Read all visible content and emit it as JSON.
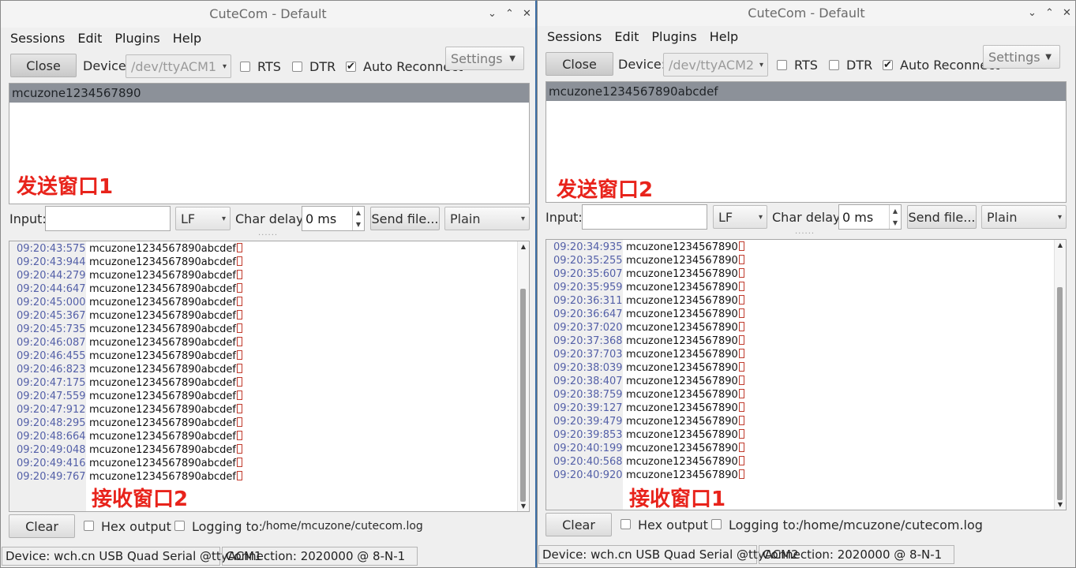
{
  "windows": [
    {
      "title": "CuteCom - Default",
      "menu": [
        "Sessions",
        "Edit",
        "Plugins",
        "Help"
      ],
      "toolbar": {
        "close_label": "Close",
        "device_label": "Device:",
        "device_value": "/dev/ttyACM1",
        "rts_label": "RTS",
        "dtr_label": "DTR",
        "auto_reconnect_label": "Auto Reconnect",
        "settings_label": "Settings"
      },
      "send_history": "mcuzone1234567890",
      "send_annotation": "发送窗口1",
      "input_row": {
        "input_label": "Input:",
        "line_end": "LF",
        "char_delay_label": "Char delay:",
        "char_delay_value": "0 ms",
        "send_file_label": "Send file...",
        "mode": "Plain"
      },
      "output_lines": [
        {
          "ts": "09:20:43:575",
          "text": "mcuzone1234567890abcdef"
        },
        {
          "ts": "09:20:43:944",
          "text": "mcuzone1234567890abcdef"
        },
        {
          "ts": "09:20:44:279",
          "text": "mcuzone1234567890abcdef"
        },
        {
          "ts": "09:20:44:647",
          "text": "mcuzone1234567890abcdef"
        },
        {
          "ts": "09:20:45:000",
          "text": "mcuzone1234567890abcdef"
        },
        {
          "ts": "09:20:45:367",
          "text": "mcuzone1234567890abcdef"
        },
        {
          "ts": "09:20:45:735",
          "text": "mcuzone1234567890abcdef"
        },
        {
          "ts": "09:20:46:087",
          "text": "mcuzone1234567890abcdef"
        },
        {
          "ts": "09:20:46:455",
          "text": "mcuzone1234567890abcdef"
        },
        {
          "ts": "09:20:46:823",
          "text": "mcuzone1234567890abcdef"
        },
        {
          "ts": "09:20:47:175",
          "text": "mcuzone1234567890abcdef"
        },
        {
          "ts": "09:20:47:559",
          "text": "mcuzone1234567890abcdef"
        },
        {
          "ts": "09:20:47:912",
          "text": "mcuzone1234567890abcdef"
        },
        {
          "ts": "09:20:48:295",
          "text": "mcuzone1234567890abcdef"
        },
        {
          "ts": "09:20:48:664",
          "text": "mcuzone1234567890abcdef"
        },
        {
          "ts": "09:20:49:048",
          "text": "mcuzone1234567890abcdef"
        },
        {
          "ts": "09:20:49:416",
          "text": "mcuzone1234567890abcdef"
        },
        {
          "ts": "09:20:49:767",
          "text": "mcuzone1234567890abcdef"
        }
      ],
      "output_annotation": "接收窗口2",
      "bottom": {
        "clear_label": "Clear",
        "hex_output_label": "Hex output",
        "logging_label": "Logging to:",
        "log_path": "/home/mcuzone/cutecom.log"
      },
      "status": {
        "device": "Device:  wch.cn USB Quad Serial @ttyACM1",
        "connection": "Connection:  2020000 @ 8-N-1"
      }
    },
    {
      "title": "CuteCom - Default",
      "menu": [
        "Sessions",
        "Edit",
        "Plugins",
        "Help"
      ],
      "toolbar": {
        "close_label": "Close",
        "device_label": "Device:",
        "device_value": "/dev/ttyACM2",
        "rts_label": "RTS",
        "dtr_label": "DTR",
        "auto_reconnect_label": "Auto Reconnect",
        "settings_label": "Settings"
      },
      "send_history": "mcuzone1234567890abcdef",
      "send_annotation": "发送窗口2",
      "input_row": {
        "input_label": "Input:",
        "line_end": "LF",
        "char_delay_label": "Char delay:",
        "char_delay_value": "0 ms",
        "send_file_label": "Send file...",
        "mode": "Plain"
      },
      "output_lines": [
        {
          "ts": "09:20:34:935",
          "text": "mcuzone1234567890"
        },
        {
          "ts": "09:20:35:255",
          "text": "mcuzone1234567890"
        },
        {
          "ts": "09:20:35:607",
          "text": "mcuzone1234567890"
        },
        {
          "ts": "09:20:35:959",
          "text": "mcuzone1234567890"
        },
        {
          "ts": "09:20:36:311",
          "text": "mcuzone1234567890"
        },
        {
          "ts": "09:20:36:647",
          "text": "mcuzone1234567890"
        },
        {
          "ts": "09:20:37:020",
          "text": "mcuzone1234567890"
        },
        {
          "ts": "09:20:37:368",
          "text": "mcuzone1234567890"
        },
        {
          "ts": "09:20:37:703",
          "text": "mcuzone1234567890"
        },
        {
          "ts": "09:20:38:039",
          "text": "mcuzone1234567890"
        },
        {
          "ts": "09:20:38:407",
          "text": "mcuzone1234567890"
        },
        {
          "ts": "09:20:38:759",
          "text": "mcuzone1234567890"
        },
        {
          "ts": "09:20:39:127",
          "text": "mcuzone1234567890"
        },
        {
          "ts": "09:20:39:479",
          "text": "mcuzone1234567890"
        },
        {
          "ts": "09:20:39:853",
          "text": "mcuzone1234567890"
        },
        {
          "ts": "09:20:40:199",
          "text": "mcuzone1234567890"
        },
        {
          "ts": "09:20:40:568",
          "text": "mcuzone1234567890"
        },
        {
          "ts": "09:20:40:920",
          "text": "mcuzone1234567890"
        }
      ],
      "output_annotation": "接收窗口1",
      "bottom": {
        "clear_label": "Clear",
        "hex_output_label": "Hex output",
        "logging_label": "Logging to:",
        "log_path": "/home/mcuzone/cutecom.log"
      },
      "status": {
        "device": "Device:  wch.cn USB Quad Serial @ttyACM2",
        "connection": "Connection:  2020000 @ 8-N-1"
      }
    }
  ],
  "glyphs": {
    "minimize": "⌄",
    "maximize": "⌃",
    "close": "✕",
    "combo_arrow": "▾",
    "settings_arrow": "▼",
    "check": "✔",
    "spin_up": "▲",
    "spin_down": "▼",
    "scroll_up": "▲",
    "scroll_down": "▼",
    "grip": "......"
  }
}
